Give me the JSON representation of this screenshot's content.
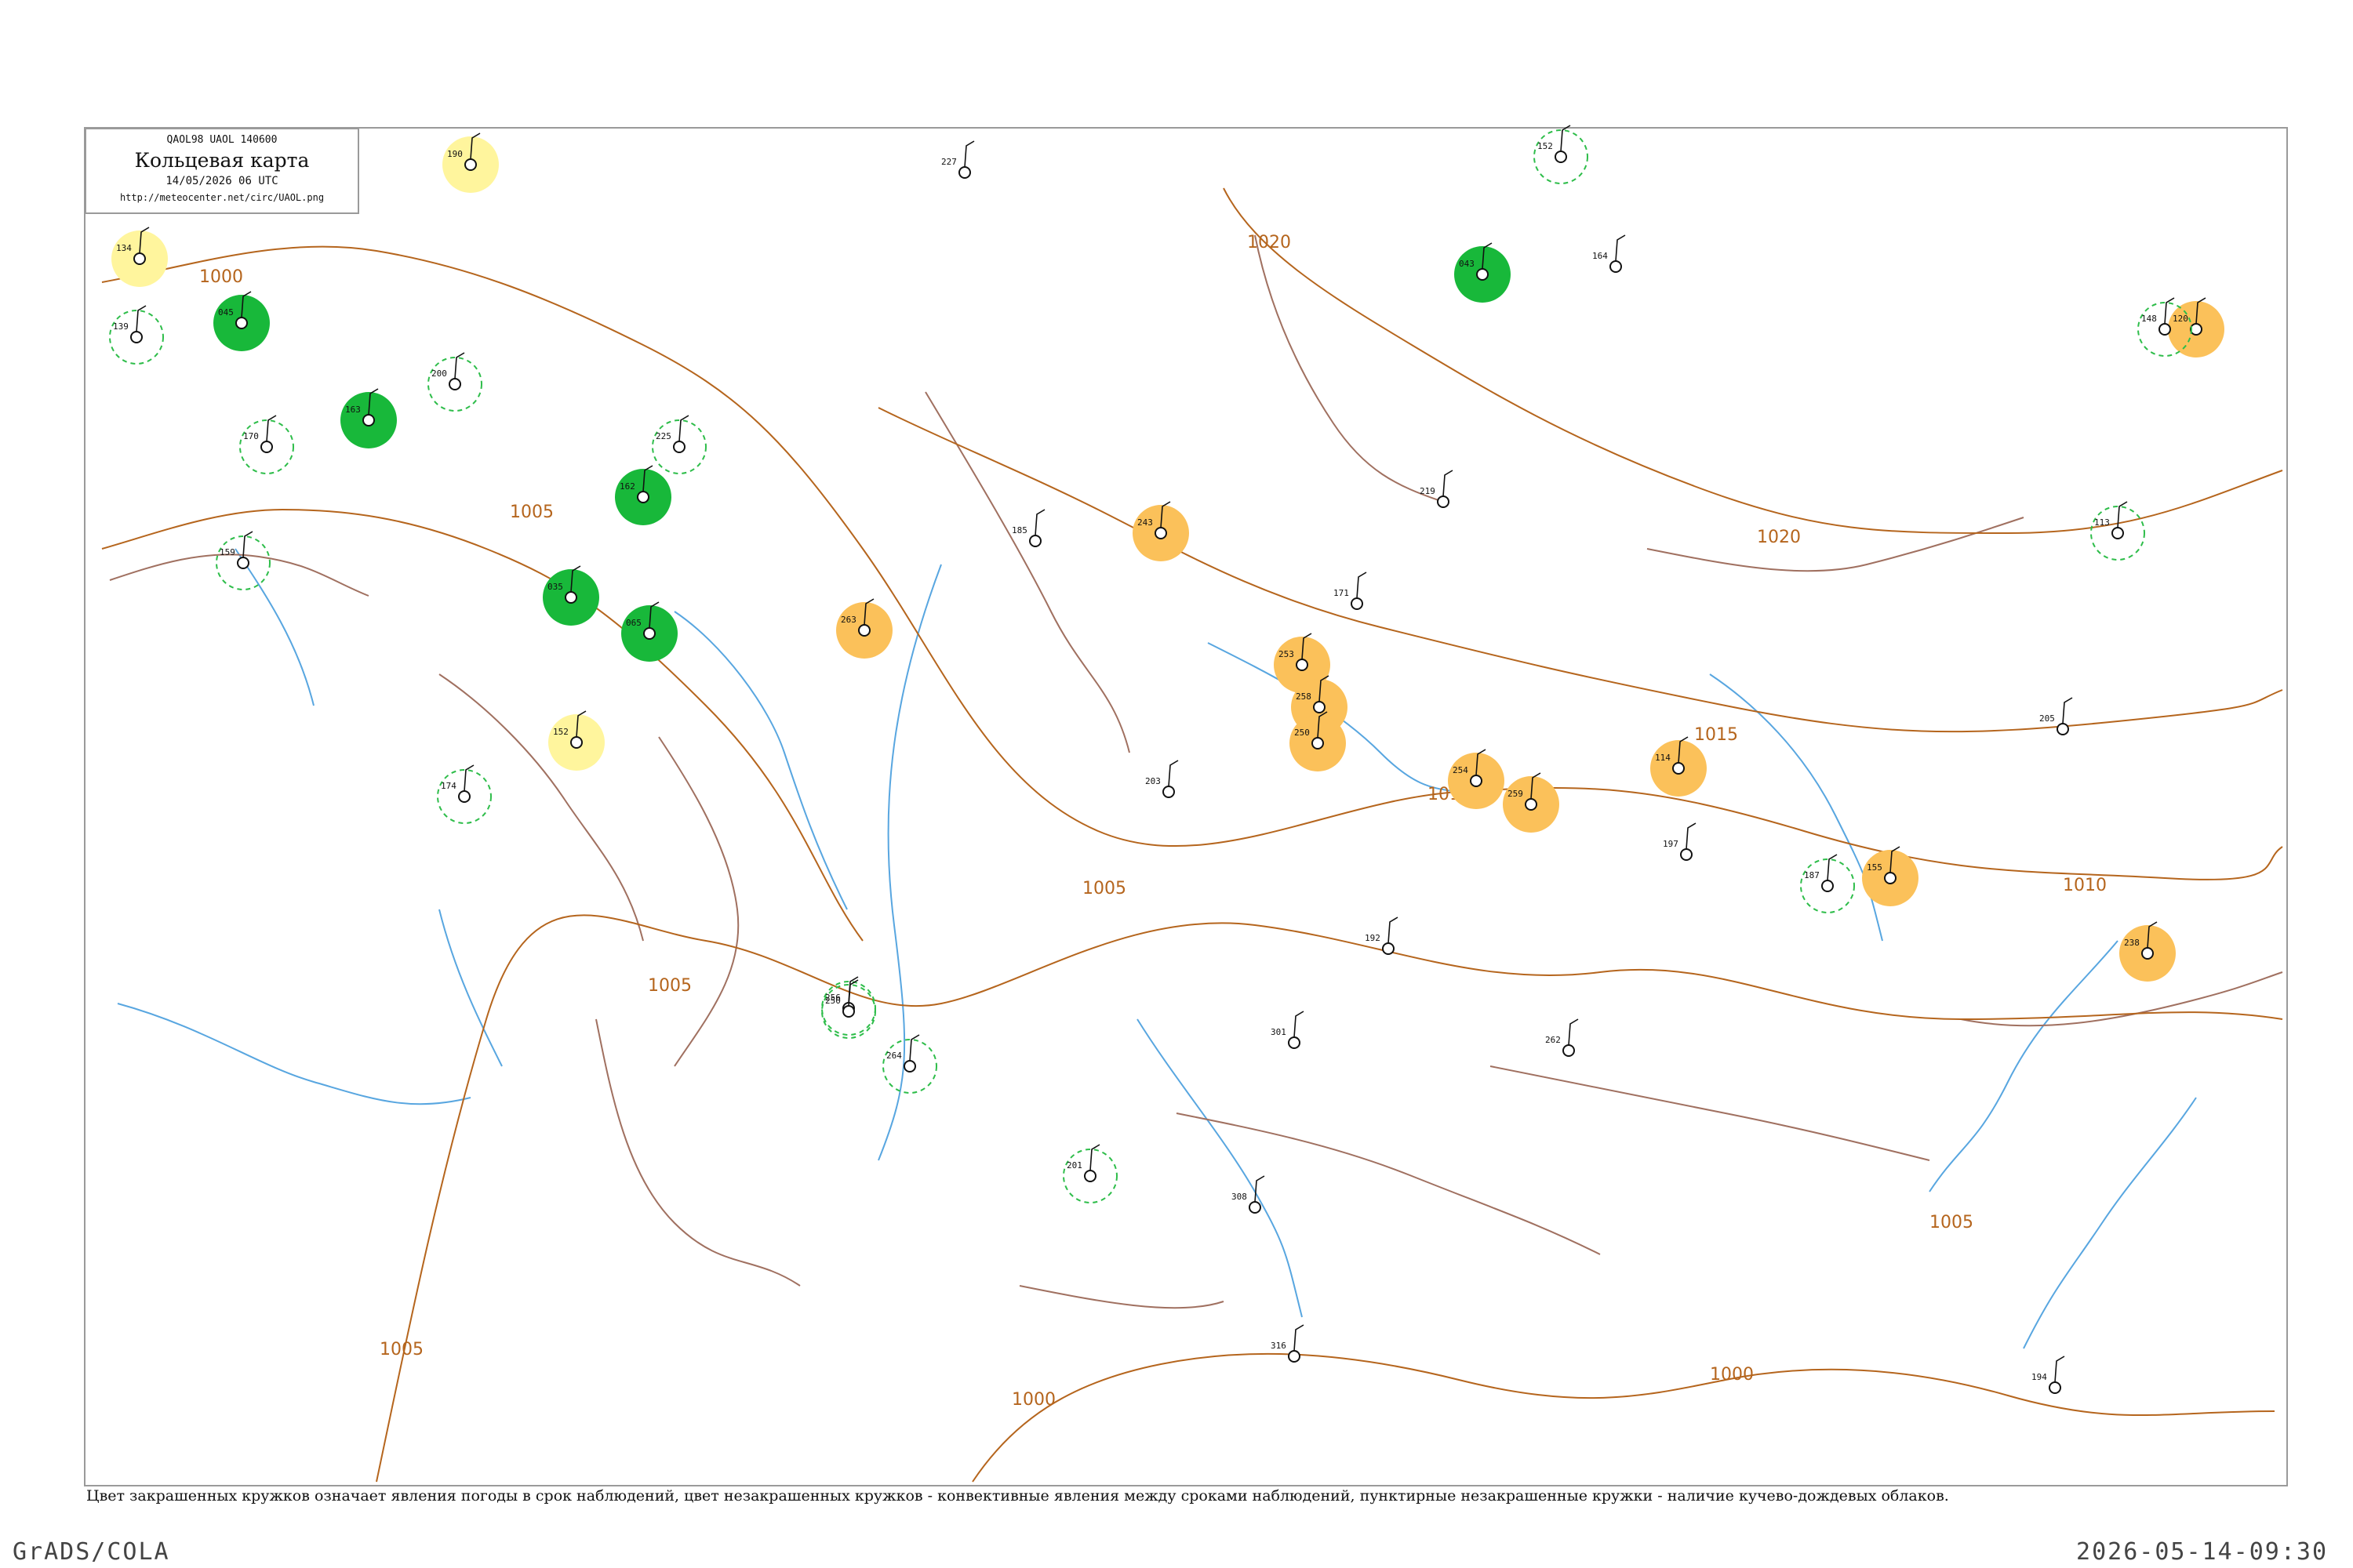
{
  "header": {
    "code_line": "QAOL98  UAOL  140600",
    "title": "Кольцевая карта",
    "date": "14/05/2026 06 UTC",
    "url": "http://meteocenter.net/circ/UAOL.png"
  },
  "isobars": {
    "labels": [
      "1000",
      "1005",
      "1010",
      "1015",
      "1020"
    ]
  },
  "legend": {
    "caption": "Цвет закрашенных кружков означает явления погоды в срок наблюдений, цвет незакрашенных кружков - конвективные явления между сроками наблюдений, пунктирные незакрашенные кружки - наличие кучево-дождевых облаков."
  },
  "footer": {
    "software": "GrADS/COLA",
    "timestamp": "2026-05-14-09:30"
  },
  "colors": {
    "border": "#9a9a9a",
    "isobar": "#b5651d",
    "river": "#58a6e0",
    "boundary": "#a07060",
    "green_fill": "#18b83a",
    "green_dash": "#2ebd4a",
    "yellow_fill": "#fff59d",
    "orange_fill": "#fbc15a",
    "station": "#111111"
  },
  "icons": [
    "station-circle-icon",
    "wind-barb-icon"
  ],
  "stations": [
    {
      "code": "190",
      "cls": "yellow"
    },
    {
      "code": "134",
      "cls": "yellow"
    },
    {
      "code": "045",
      "cls": "green"
    },
    {
      "code": "163",
      "cls": "green"
    },
    {
      "code": "065",
      "cls": "green"
    },
    {
      "code": "162",
      "cls": "green"
    },
    {
      "code": "035",
      "cls": "green"
    },
    {
      "code": "043",
      "cls": "green"
    },
    {
      "code": "152",
      "cls": "yellow"
    },
    {
      "code": "243",
      "cls": "orange"
    },
    {
      "code": "263",
      "cls": "orange"
    },
    {
      "code": "253",
      "cls": "orange"
    },
    {
      "code": "258",
      "cls": "orange"
    },
    {
      "code": "250",
      "cls": "orange"
    },
    {
      "code": "254",
      "cls": "orange"
    },
    {
      "code": "259",
      "cls": "orange"
    },
    {
      "code": "114",
      "cls": "orange"
    },
    {
      "code": "238",
      "cls": "orange"
    },
    {
      "code": "155",
      "cls": "orange"
    },
    {
      "code": "120",
      "cls": "orange"
    },
    {
      "code": "139",
      "cls": "dashed"
    },
    {
      "code": "170",
      "cls": "dashed"
    },
    {
      "code": "159",
      "cls": "dashed"
    },
    {
      "code": "174",
      "cls": "dashed"
    },
    {
      "code": "200",
      "cls": "dashed"
    },
    {
      "code": "225",
      "cls": "dashed"
    },
    {
      "code": "256",
      "cls": "dashed"
    },
    {
      "code": "250",
      "cls": "dashed"
    },
    {
      "code": "264",
      "cls": "dashed"
    },
    {
      "code": "201",
      "cls": "dashed"
    },
    {
      "code": "152",
      "cls": "dashed"
    },
    {
      "code": "148",
      "cls": "dashed"
    },
    {
      "code": "113",
      "cls": "dashed"
    },
    {
      "code": "187",
      "cls": "dashed"
    },
    {
      "code": "227",
      "cls": "plain"
    },
    {
      "code": "185",
      "cls": "plain"
    },
    {
      "code": "203",
      "cls": "plain"
    },
    {
      "code": "192",
      "cls": "plain"
    },
    {
      "code": "219",
      "cls": "plain"
    },
    {
      "code": "205",
      "cls": "plain"
    },
    {
      "code": "301",
      "cls": "plain"
    },
    {
      "code": "262",
      "cls": "plain"
    },
    {
      "code": "171",
      "cls": "plain"
    },
    {
      "code": "197",
      "cls": "plain"
    },
    {
      "code": "164",
      "cls": "plain"
    },
    {
      "code": "308",
      "cls": "plain"
    },
    {
      "code": "316",
      "cls": "plain"
    },
    {
      "code": "194",
      "cls": "plain"
    }
  ]
}
